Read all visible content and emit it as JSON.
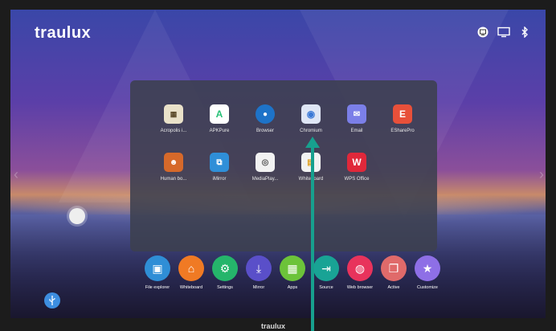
{
  "brand": "traulux",
  "bezel_brand": "traulux",
  "status_icons": [
    "monitor-network-icon",
    "display-icon",
    "bluetooth-icon"
  ],
  "apps": [
    {
      "label": "Acropolis i...",
      "icon": "acropolis-icon",
      "color": "#e9e1c9"
    },
    {
      "label": "APKPure",
      "icon": "apkpure-icon",
      "color": "#ffffff"
    },
    {
      "label": "Browser",
      "icon": "browser-icon",
      "color": "#1e73c8"
    },
    {
      "label": "Chromium",
      "icon": "chromium-icon",
      "color": "#dfe6f5"
    },
    {
      "label": "Email",
      "icon": "email-icon",
      "color": "#7b7fe8"
    },
    {
      "label": "ESharePro",
      "icon": "esharepro-icon",
      "color": "#e8503a"
    },
    {
      "label": "Human bo...",
      "icon": "human-body-icon",
      "color": "#d6692a"
    },
    {
      "label": "iMirror",
      "icon": "imirror-icon",
      "color": "#2f8fd8"
    },
    {
      "label": "MediaPlay...",
      "icon": "mediaplayer-icon",
      "color": "#f2f2f2"
    },
    {
      "label": "Whiteboard",
      "icon": "whiteboard-icon",
      "color": "#f2f2f2"
    },
    {
      "label": "WPS Office",
      "icon": "wps-office-icon",
      "color": "#e0283a"
    }
  ],
  "dock": [
    {
      "label": "File explorer",
      "icon": "file-explorer-icon",
      "color": "#2f8ed6"
    },
    {
      "label": "Whiteboard",
      "icon": "whiteboard-icon",
      "color": "#f07a24"
    },
    {
      "label": "Settings",
      "icon": "settings-icon",
      "color": "#25b56b"
    },
    {
      "label": "Mirror",
      "icon": "mirror-icon",
      "color": "#5a4fc9"
    },
    {
      "label": "Apps",
      "icon": "apps-icon",
      "color": "#6cc33a"
    },
    {
      "label": "Source",
      "icon": "source-icon",
      "color": "#19a395"
    },
    {
      "label": "Web browser",
      "icon": "web-browser-icon",
      "color": "#e8335c"
    },
    {
      "label": "Active",
      "icon": "active-icon",
      "color": "#e06a6a"
    },
    {
      "label": "Customize",
      "icon": "customize-icon",
      "color": "#8e6fe6"
    }
  ]
}
